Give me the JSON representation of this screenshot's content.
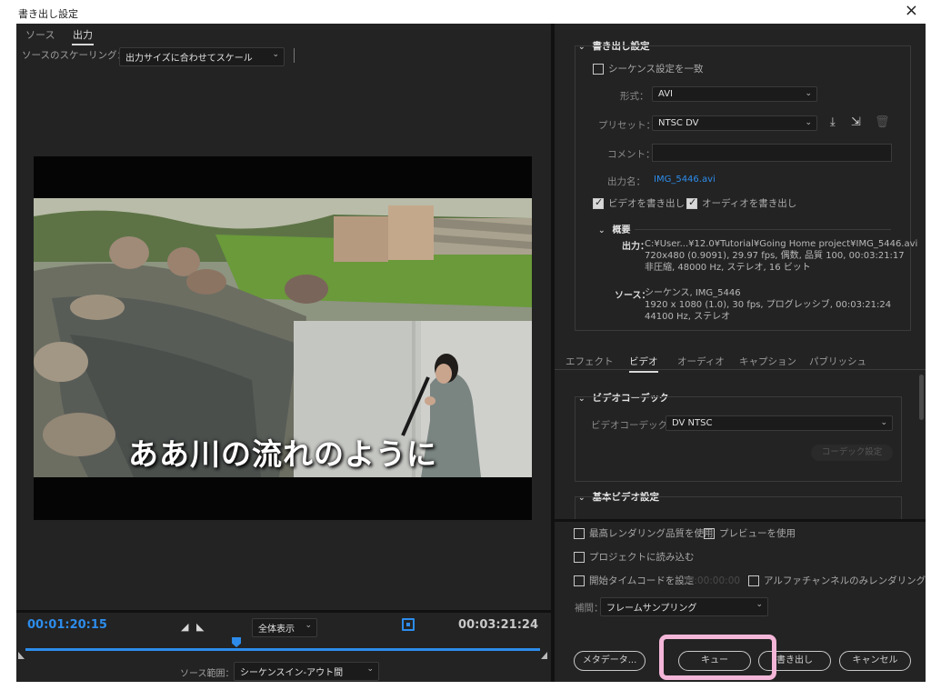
{
  "window": {
    "title": "書き出し設定",
    "close_glyph": "×"
  },
  "left": {
    "tabs": [
      "ソース",
      "出力"
    ],
    "active_tab": "出力",
    "scaling_label": "ソースのスケーリング：",
    "scaling_value": "出力サイズに合わせてスケール",
    "caption": "ああ川の流れのように"
  },
  "timeline": {
    "current_timecode": "00:01:20:15",
    "duration_timecode": "00:03:21:24",
    "fit_value": "全体表示",
    "playhead_fraction": 0.41,
    "source_range_label": "ソース範囲：",
    "source_range_value": "シーケンスイン-アウト間"
  },
  "export_settings": {
    "section_title": "書き出し設定",
    "match_sequence": {
      "label": "シーケンス設定を一致",
      "checked": false
    },
    "format_label": "形式：",
    "format_value": "AVI",
    "preset_label": "プリセット：",
    "preset_value": "NTSC DV",
    "comment_label": "コメント：",
    "comment_value": "",
    "output_name_label": "出力名：",
    "output_name_value": "IMG_5446.avi",
    "export_video": {
      "label": "ビデオを書き出し",
      "checked": true
    },
    "export_audio": {
      "label": "オーディオを書き出し",
      "checked": true
    },
    "summary": {
      "title": "概要",
      "output_label": "出力：",
      "output_lines": [
        "C:¥User...¥12.0¥Tutorial¥Going Home project¥IMG_5446.avi",
        "720x480 (0.9091), 29.97 fps, 偶数, 品質 100, 00:03:21:17",
        "非圧縮, 48000 Hz, ステレオ, 16 ビット"
      ],
      "source_label": "ソース：",
      "source_lines": [
        "シーケンス, IMG_5446",
        "1920 x 1080 (1.0), 30 fps, プログレッシブ, 00:03:21:24",
        "44100 Hz, ステレオ"
      ]
    }
  },
  "subtabs": [
    "エフェクト",
    "ビデオ",
    "オーディオ",
    "キャプション",
    "パブリッシュ"
  ],
  "active_subtab": "ビデオ",
  "video_codec": {
    "section_title": "ビデオコーデック",
    "codec_label": "ビデオコーデック：",
    "codec_value": "DV NTSC",
    "codec_settings_button": "コーデック設定"
  },
  "basic_video": {
    "section_title": "基本ビデオ設定"
  },
  "bottom_options": {
    "max_render_quality": "最高レンダリング品質を使用",
    "use_previews": "プレビューを使用",
    "import_into_project": "プロジェクトに読み込む",
    "set_start_timecode": "開始タイムコードを設定",
    "start_timecode_value": "00:00:00:00",
    "render_alpha_only": "アルファチャンネルのみレンダリング",
    "interpolation_label": "補間：",
    "interpolation_value": "フレームサンプリング"
  },
  "buttons": {
    "metadata": "メタデータ...",
    "queue": "キュー",
    "export": "書き出し",
    "cancel": "キャンセル"
  },
  "colors": {
    "accent": "#2d8ceb",
    "panel": "#232323",
    "highlight": "#f4b6d8"
  }
}
